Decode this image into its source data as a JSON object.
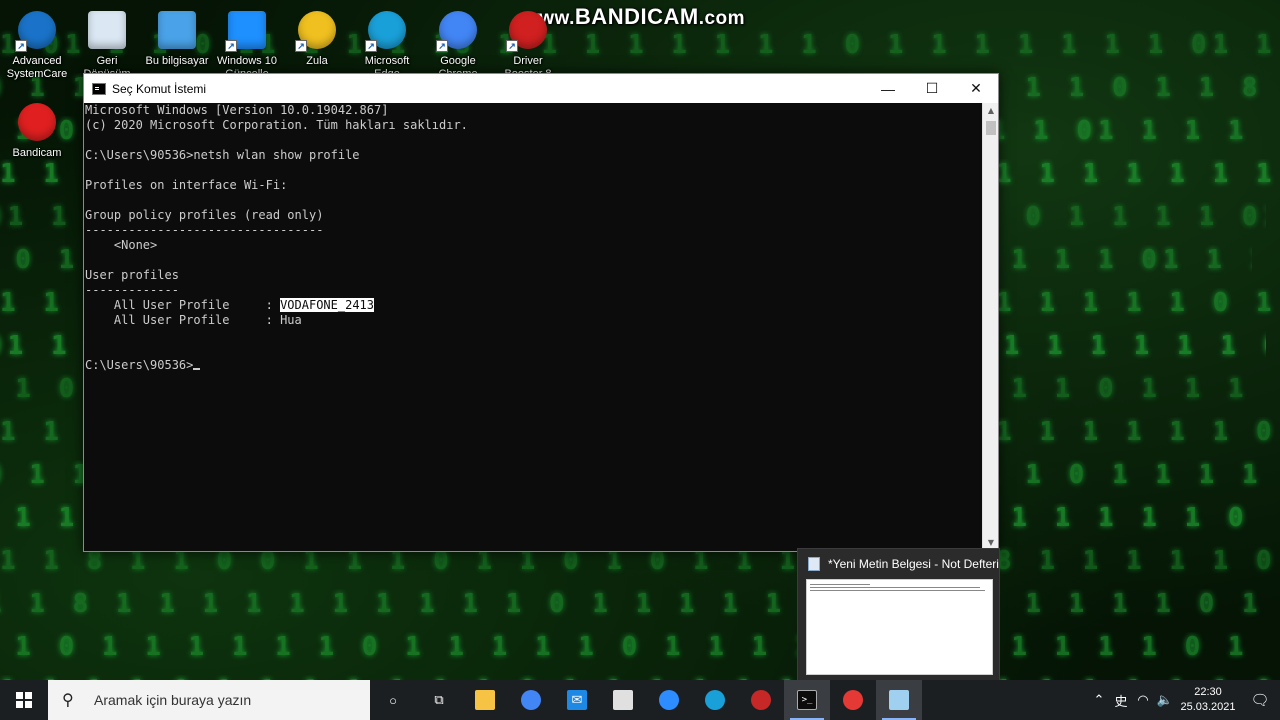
{
  "watermark": {
    "prefix": "www.",
    "brand": "BANDICAM",
    "suffix": ".com"
  },
  "background": {
    "rows": [
      "1 01   1 1 0   11 1   1  1  18 1 1 1  1 1  1 1 1 0 1 1  1 1 1 1",
      "0 1   1 8  1 1   1  01  1 1 0 1   1 1  1 0 11  1 1 1 0 1 1 1 1",
      "1  1 0 01 1  1 1 1  0 1 1 1  1 1  0 01  1  11 1 0 1 1 1 1 01 1",
      "1 1 1  1 1 0  1  1 1 1  0 1 1 1  1 1 1 0  1 1  1 1  0 1 1 1 1 1",
      "01 1  1 0 1 1 1  1 1 1 01 1 1  1  1 1 1  0 1 1 1 1 1 0 1 1 1 1",
      "1 0 1 1 1 1  1 0 1 1 1 1 1 0 1 1 1 1 1 1 0 1 1 1 1 1 1 01 1 1",
      "1 1 1 0 1 1 1 1 1 1 0 1 1 1 1 1 1 1 1 0 1 1 1 1 1 1 1 1 0 1 1",
      "01 1 1 1 1 0 1 1 1 1 1 1 1 0 1 1 1 1 1 1 1 0 1 1 1 1 1 1 1 01",
      "1 1 0 1 1 1 1 1 1 1 0 1 1 1 1 1 1 1 0 1 1 1 1 1 1 1 0 1 1 1 1",
      "1 1 1 1 0 1 1 1 1 1 1 1 0 1 1 1 1 1 1 1 1 0 1 1 1 1 1 1 1 0 1",
      "0 1 1 1 1 1 1 0 1 1 1 1 1 1 1 1 0 1 1 1 1 1 1 1 1 0 1 1 1 1 1",
      "1 1 1 1 1 1 1 1 1 0 1 1 1 1 1 1 1 1 1 0 1 1 1 1 1 1 1 1 1 0 1",
      "1 1 8 1 1 0 0 1 1 1 0 1 1 0 1 0 1 1 1 1 1 0 1 8 1 1 1 1 1 0 1",
      "1 1 8 1 1 1 1 1 1 1 1 1 1 0 1 1 1 1 1 1 0 1 1 1 1 1 1 1 0 1 1",
      "1 1 0 1 1 1 1 1 1 0 1 1 1 1 1 0 1 1 1 1 1 0 1 1 1 1 1 1 0 1 1",
      "1 1 1 1 0 1 1 1 1 1 1 1 0 1 1 1 1 1 1 1 0 1 1 1 1 1 1 1 1 0 1"
    ]
  },
  "desktop_icons": [
    {
      "label": "Advanced SystemCare",
      "icon": "advanced-systemcare-icon",
      "color": "#1a73c8"
    },
    {
      "label": "Geri Dönüşüm",
      "icon": "recycle-bin-icon",
      "color": "#dbe8f4"
    },
    {
      "label": "Bu bilgisayar",
      "icon": "this-pc-icon",
      "color": "#4aa3e8"
    },
    {
      "label": "Windows 10 Güncelle",
      "icon": "windows-update-icon",
      "color": "#1e90ff"
    },
    {
      "label": "Zula",
      "icon": "zula-icon",
      "color": "#f0c020"
    },
    {
      "label": "Microsoft Edge",
      "icon": "edge-icon",
      "color": "#1aa0d8"
    },
    {
      "label": "Google Chrome",
      "icon": "chrome-icon",
      "color": "#4285f4"
    },
    {
      "label": "Driver Booster 8",
      "icon": "driver-booster-icon",
      "color": "#d02020"
    },
    {
      "label": "Bandicam",
      "icon": "bandicam-icon",
      "color": "#e02020"
    }
  ],
  "cmd": {
    "title": "Seç Komut İstemi",
    "lines": [
      "Microsoft Windows [Version 10.0.19042.867]",
      "(c) 2020 Microsoft Corporation. Tüm hakları saklıdır.",
      "",
      "C:\\Users\\90536>netsh wlan show profile",
      "",
      "Profiles on interface Wi-Fi:",
      "",
      "Group policy profiles (read only)",
      "---------------------------------",
      "    <None>",
      "",
      "User profiles",
      "-------------",
      "    All User Profile     : ",
      "    All User Profile     : Hua",
      "",
      "",
      "C:\\Users\\90536>"
    ],
    "selected_text": "VODAFONE_2413",
    "minimize": "—",
    "maximize": "☐",
    "close": "✕"
  },
  "preview": {
    "title": "*Yeni Metin Belgesi - Not Defteri"
  },
  "taskbar": {
    "search_placeholder": "Aramak için buraya yazın",
    "apps": [
      {
        "name": "cortana-icon",
        "active": false
      },
      {
        "name": "task-view-icon",
        "active": false
      },
      {
        "name": "file-explorer-icon",
        "active": false
      },
      {
        "name": "chrome-icon",
        "active": false
      },
      {
        "name": "mail-icon",
        "active": false
      },
      {
        "name": "store-icon",
        "active": false
      },
      {
        "name": "zoom-icon",
        "active": false
      },
      {
        "name": "edge-icon",
        "active": false
      },
      {
        "name": "driver-booster-icon",
        "active": false
      },
      {
        "name": "cmd-icon",
        "active": true
      },
      {
        "name": "bandicam-icon",
        "active": false
      },
      {
        "name": "notepad-icon",
        "active": true
      }
    ],
    "time": "22:30",
    "date": "25.03.2021",
    "ime_label": "史"
  }
}
